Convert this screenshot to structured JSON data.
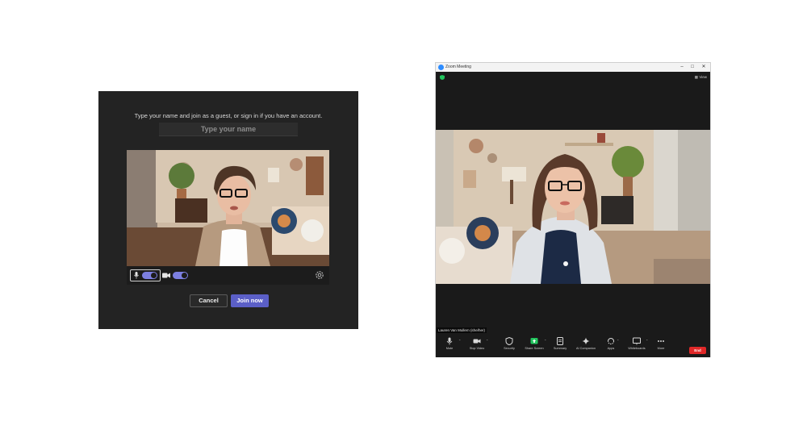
{
  "teams": {
    "prompt": "Type your name and join as a guest, or sign in if you have an account.",
    "name_placeholder": "Type your name",
    "cancel_label": "Cancel",
    "join_label": "Join now",
    "mic_on": true,
    "camera_on": true,
    "accent_color": "#5b5fc7"
  },
  "zoom": {
    "window_title": "Zoom Meeting",
    "view_label": "View",
    "participant_name": "Lauren Van Mullem (she/her)",
    "toolbar": [
      {
        "label": "Mute",
        "icon": "microphone-icon"
      },
      {
        "label": "Stop Video",
        "icon": "video-camera-icon"
      },
      {
        "label": "Security",
        "icon": "shield-icon"
      },
      {
        "label": "Share Screen",
        "icon": "share-screen-icon"
      },
      {
        "label": "Summary",
        "icon": "summary-icon"
      },
      {
        "label": "AI Companion",
        "icon": "sparkle-icon"
      },
      {
        "label": "Apps",
        "icon": "apps-icon"
      },
      {
        "label": "Whiteboards",
        "icon": "whiteboard-icon"
      },
      {
        "label": "More",
        "icon": "more-icon"
      }
    ],
    "end_label": "End",
    "share_color": "#22c55e",
    "end_color": "#e02828"
  }
}
